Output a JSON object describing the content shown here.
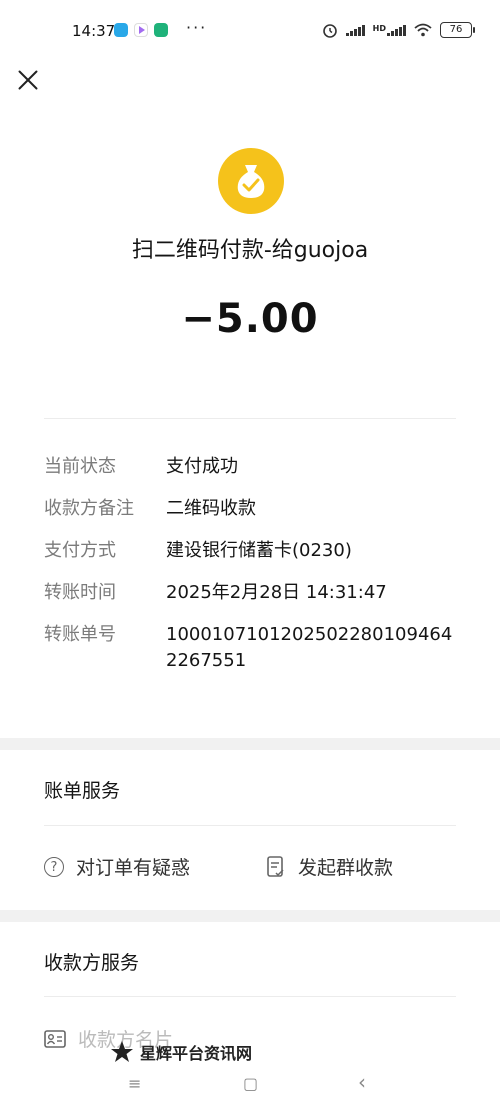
{
  "status_bar": {
    "time": "14:37",
    "more": "···",
    "network_label": "HD",
    "battery": "76"
  },
  "header": {
    "close_icon": "close-icon",
    "title": "扫二维码付款-给guojoa",
    "amount": "−5.00",
    "icon": "money-bag-icon",
    "icon_color": "#f5c21b"
  },
  "details": [
    {
      "label": "当前状态",
      "value": "支付成功"
    },
    {
      "label": "收款方备注",
      "value": "二维码收款"
    },
    {
      "label": "支付方式",
      "value": "建设银行储蓄卡(0230)"
    },
    {
      "label": "转账时间",
      "value": "2025年2月28日 14:31:47"
    },
    {
      "label": "转账单号",
      "value": "1000107101202502280109464 2267551"
    }
  ],
  "bill_service": {
    "title": "账单服务",
    "items": [
      {
        "label": "对订单有疑惑",
        "icon": "question-icon"
      },
      {
        "label": "发起群收款",
        "icon": "document-icon"
      }
    ]
  },
  "payee_service": {
    "title": "收款方服务",
    "items": [
      {
        "label": "收款方名片",
        "icon": "contact-card-icon"
      }
    ]
  },
  "watermark": "星辉平台资讯网",
  "nav": {
    "menu": "≡",
    "home": "▢",
    "back": "‹"
  }
}
